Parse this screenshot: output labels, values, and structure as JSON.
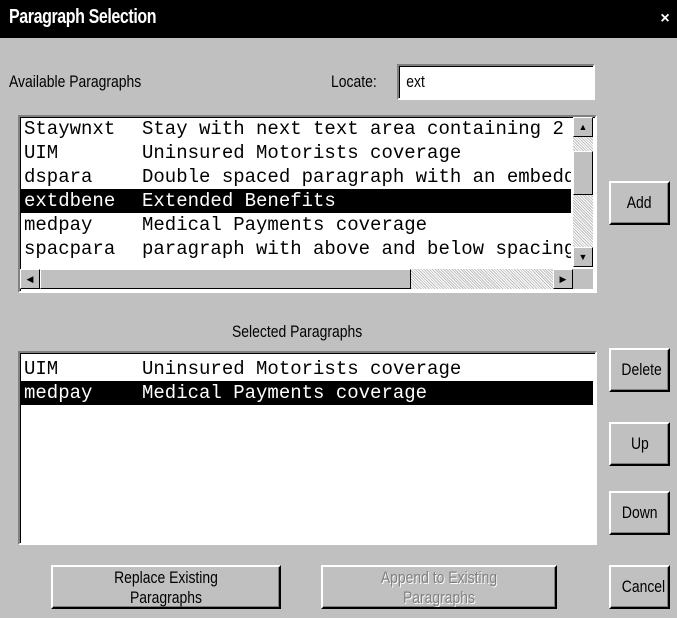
{
  "window": {
    "title": "Paragraph Selection",
    "close_glyph": "×"
  },
  "available": {
    "label": "Available Paragraphs",
    "locate_label": "Locate:",
    "locate_value": "ext",
    "rows": [
      {
        "code": "Staywnxt",
        "desc": "Stay with next text area containing 2",
        "selected": false
      },
      {
        "code": "UIM",
        "desc": "Uninsured Motorists coverage",
        "selected": false
      },
      {
        "code": "dspara",
        "desc": "Double spaced paragraph with an embedd",
        "selected": false
      },
      {
        "code": "extdbene",
        "desc": "Extended Benefits",
        "selected": true
      },
      {
        "code": "medpay",
        "desc": "Medical Payments coverage",
        "selected": false
      },
      {
        "code": "spacpara",
        "desc": "paragraph with above and below spacing",
        "selected": false
      }
    ]
  },
  "selected": {
    "label": "Selected Paragraphs",
    "rows": [
      {
        "code": "UIM",
        "desc": "Uninsured Motorists coverage",
        "selected": false
      },
      {
        "code": "medpay",
        "desc": "Medical Payments coverage",
        "selected": true
      }
    ]
  },
  "buttons": {
    "add": "Add",
    "delete": "Delete",
    "up": "Up",
    "down": "Down",
    "replace": "Replace Existing Paragraphs",
    "append": "Append to Existing Paragraphs",
    "cancel": "Cancel"
  },
  "icons": {
    "scroll_up": "scroll-up-arrow-icon",
    "scroll_down": "scroll-down-arrow-icon",
    "scroll_left": "scroll-left-arrow-icon",
    "scroll_right": "scroll-right-arrow-icon"
  }
}
